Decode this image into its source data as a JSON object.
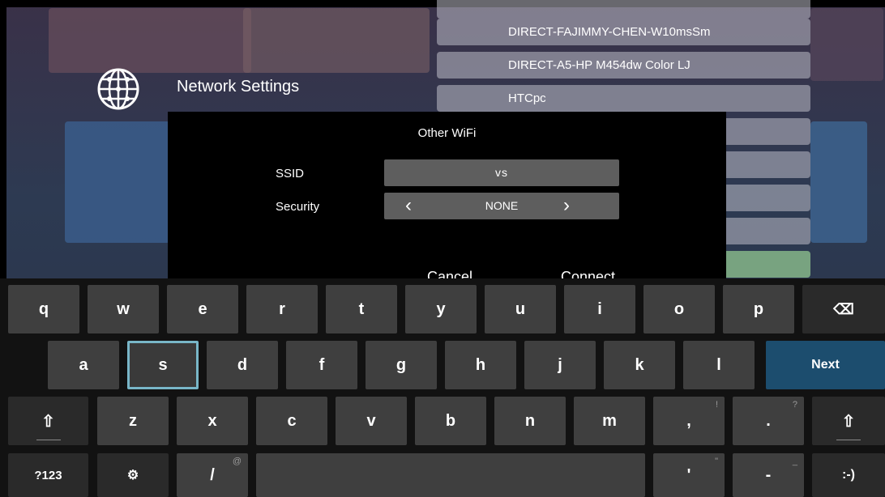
{
  "header": {
    "title": "Network Settings",
    "icon": "globe-icon"
  },
  "wifi_list": [
    "DIRECT-FAJIMMY-CHEN-W10msSm",
    "DIRECT-A5-HP M454dw Color LJ",
    "HTCpc",
    "",
    "",
    "",
    "",
    ""
  ],
  "dialog": {
    "title": "Other WiFi",
    "ssid_label": "SSID",
    "ssid_value": "vs",
    "security_label": "Security",
    "security_value": "NONE",
    "prev_glyph": "‹",
    "next_glyph": "›",
    "cancel_label": "Cancel",
    "connect_label": "Connect"
  },
  "keyboard": {
    "row1": [
      "q",
      "w",
      "e",
      "r",
      "t",
      "y",
      "u",
      "i",
      "o",
      "p"
    ],
    "backspace": "⌫",
    "row2": [
      "a",
      "s",
      "d",
      "f",
      "g",
      "h",
      "j",
      "k",
      "l"
    ],
    "selected_key": "s",
    "next_label": "Next",
    "shift": "⇧",
    "row3": [
      "z",
      "x",
      "c",
      "v",
      "b",
      "n",
      "m"
    ],
    "comma": ",",
    "comma_hint": "!",
    "period": ".",
    "period_hint": "?",
    "symbols_label": "?123",
    "settings_glyph": "⚙",
    "slash": "/",
    "slash_hint": "@",
    "apostrophe": "'",
    "apostrophe_hint": "\"",
    "dash": "-",
    "dash_hint": "_",
    "smiley": ":-)"
  },
  "colors": {
    "next_key": "#1c4d6e",
    "selected_border": "#78b6c8",
    "key": "#3f3f3f"
  }
}
